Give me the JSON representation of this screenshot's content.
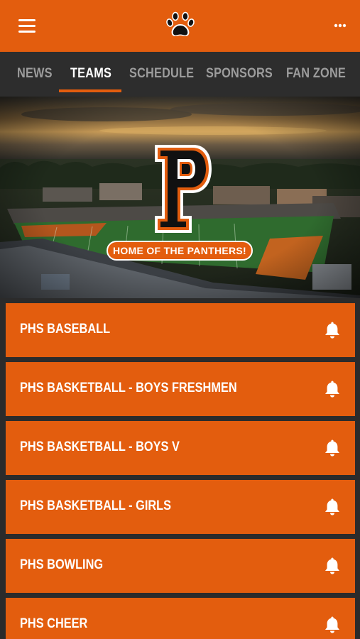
{
  "app": {
    "logo_icon": "paw-icon",
    "menu_icon": "hamburger-menu-icon",
    "more_icon": "more-dots-icon",
    "accent_color": "#e35d0e"
  },
  "tabs": [
    {
      "label": "NEWS",
      "active": false
    },
    {
      "label": "TEAMS",
      "active": true
    },
    {
      "label": "SCHEDULE",
      "active": false
    },
    {
      "label": "SPONSORS",
      "active": false
    },
    {
      "label": "FAN ZONE",
      "active": false
    }
  ],
  "hero": {
    "logo_letter": "P",
    "banner_text": "HOME OF THE PANTHERS!"
  },
  "teams": [
    {
      "name": "PHS BASEBALL",
      "icon": "bell-icon"
    },
    {
      "name": "PHS BASKETBALL - BOYS FRESHMEN",
      "icon": "bell-icon"
    },
    {
      "name": "PHS BASKETBALL - BOYS V",
      "icon": "bell-icon"
    },
    {
      "name": "PHS BASKETBALL - GIRLS",
      "icon": "bell-icon"
    },
    {
      "name": "PHS BOWLING",
      "icon": "bell-icon"
    },
    {
      "name": "PHS CHEER",
      "icon": "bell-icon"
    }
  ]
}
